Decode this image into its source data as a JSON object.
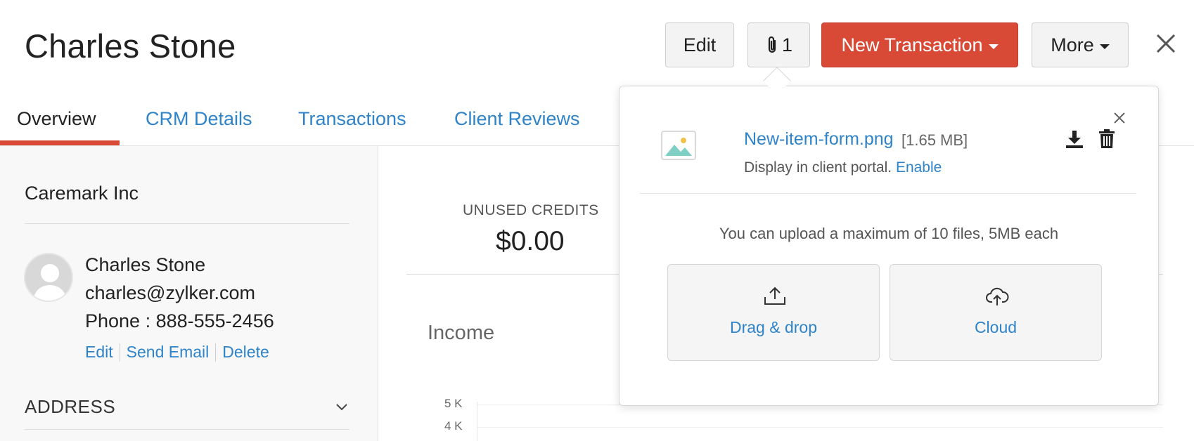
{
  "header": {
    "title": "Charles Stone",
    "edit_label": "Edit",
    "attachment_count": "1",
    "new_transaction_label": "New Transaction",
    "more_label": "More"
  },
  "tabs": [
    {
      "label": "Overview",
      "active": true
    },
    {
      "label": "CRM Details",
      "active": false
    },
    {
      "label": "Transactions",
      "active": false
    },
    {
      "label": "Client Reviews",
      "active": false
    }
  ],
  "sidebar": {
    "company": "Caremark Inc",
    "contact": {
      "name": "Charles Stone",
      "email": "charles@zylker.com",
      "phone": "Phone : 888-555-2456"
    },
    "actions": {
      "edit": "Edit",
      "send_email": "Send Email",
      "delete": "Delete"
    },
    "address_label": "ADDRESS"
  },
  "main": {
    "unused_credits_label": "UNUSED CREDITS",
    "unused_credits_value": "$0.00",
    "income_label": "Income",
    "y_ticks": [
      "5 K",
      "4 K"
    ]
  },
  "attachments_popover": {
    "file": {
      "name": "New-item-form.png",
      "size": "[1.65 MB]",
      "portal_text": "Display in client portal.",
      "portal_action": "Enable"
    },
    "upload_note": "You can upload a maximum of 10 files, 5MB each",
    "drag_drop_label": "Drag & drop",
    "cloud_label": "Cloud"
  },
  "colors": {
    "accent_red": "#d94a36",
    "link_blue": "#2f83c9"
  }
}
